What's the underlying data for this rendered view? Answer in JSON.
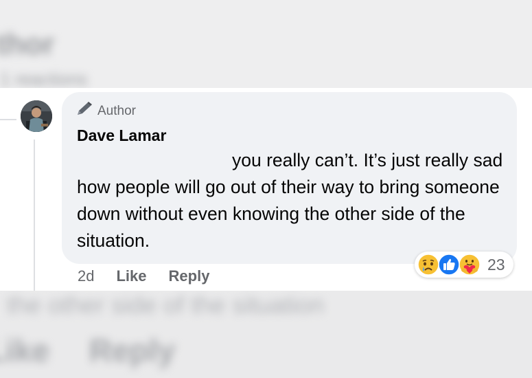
{
  "comment": {
    "badge_label": "Author",
    "badge_icon": "pencil-icon",
    "commenter_name": "Dave Lamar",
    "text": "you really can’t. It’s just really sad how people will go out of their way to bring someone down without even knowing the other side of the situation.",
    "timestamp": "2d",
    "like_label": "Like",
    "reply_label": "Reply",
    "reactions": {
      "icons": [
        "sad-face-icon",
        "thumbs-up-icon",
        "care-heart-hug-icon"
      ],
      "count": "23"
    }
  },
  "colors": {
    "bubble_bg": "#f0f2f5",
    "secondary_text": "#65676b",
    "primary_text": "#050505",
    "like_blue": "#1877f2"
  }
}
